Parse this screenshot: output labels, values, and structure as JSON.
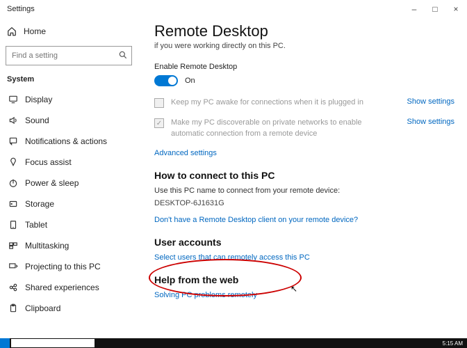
{
  "window": {
    "title": "Settings"
  },
  "winbtns": {
    "min": "–",
    "max": "□",
    "close": "×"
  },
  "sidebar": {
    "home": "Home",
    "search_placeholder": "Find a setting",
    "group": "System",
    "items": [
      {
        "label": "Display"
      },
      {
        "label": "Sound"
      },
      {
        "label": "Notifications & actions"
      },
      {
        "label": "Focus assist"
      },
      {
        "label": "Power & sleep"
      },
      {
        "label": "Storage"
      },
      {
        "label": "Tablet"
      },
      {
        "label": "Multitasking"
      },
      {
        "label": "Projecting to this PC"
      },
      {
        "label": "Shared experiences"
      },
      {
        "label": "Clipboard"
      }
    ]
  },
  "main": {
    "title": "Remote Desktop",
    "subtitle": "if you were working directly on this PC.",
    "enable_label": "Enable Remote Desktop",
    "toggle_state": "On",
    "opt1": "Keep my PC awake for connections when it is plugged in",
    "opt2": "Make my PC discoverable on private networks to enable automatic connection from a remote device",
    "show_settings": "Show settings",
    "advanced": "Advanced settings",
    "connect_head": "How to connect to this PC",
    "connect_text": "Use this PC name to connect from your remote device:",
    "pc_name": "DESKTOP-6J1631G",
    "no_client": "Don't have a Remote Desktop client on your remote device?",
    "users_head": "User accounts",
    "users_link": "Select users that can remotely access this PC",
    "help_head": "Help from the web",
    "help_link": "Solving PC problems remotely"
  },
  "taskbar": {
    "time": "5:15 AM"
  }
}
